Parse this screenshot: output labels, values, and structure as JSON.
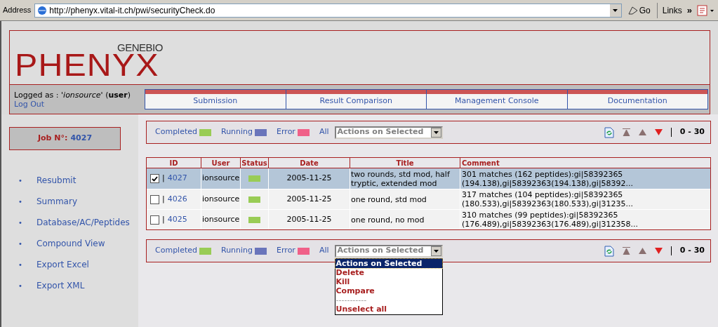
{
  "browser": {
    "address_label": "Address",
    "url": "http://phenyx.vital-it.ch/pwi/securityCheck.do",
    "go_label": "Go",
    "links_label": "Links",
    "chevron": "»"
  },
  "header": {
    "logo_top": "GENEBIO",
    "logo": "PHENYX",
    "logged_as": "Logged as : '*ionsource*' (**user**)",
    "logout": "Log Out",
    "nav_tabs": [
      {
        "label": "Submission"
      },
      {
        "label": "Result Comparison"
      },
      {
        "label": "Management Console"
      },
      {
        "label": "Documentation"
      }
    ]
  },
  "sidebar": {
    "job_label": "Job N°:",
    "job_number": "4027",
    "bullet": "•",
    "links": [
      {
        "label": "Resubmit"
      },
      {
        "label": "Summary"
      },
      {
        "label": "Database/AC/Peptides"
      },
      {
        "label": "Compound View"
      },
      {
        "label": "Export Excel"
      },
      {
        "label": "Export XML"
      }
    ]
  },
  "filter_bars": [
    {
      "legend": [
        {
          "label": "Completed",
          "color": "#99cc55"
        },
        {
          "label": "Running",
          "color": "#6a75bb"
        },
        {
          "label": "Error",
          "color": "#f06088"
        }
      ],
      "all_label": "All",
      "select_value": "Actions on Selected",
      "range": "0 - 30"
    },
    {
      "legend": [
        {
          "label": "Completed",
          "color": "#99cc55"
        },
        {
          "label": "Running",
          "color": "#6a75bb"
        },
        {
          "label": "Error",
          "color": "#f06088"
        }
      ],
      "all_label": "All",
      "select_value": "Actions on Selected",
      "range": "0 - 30",
      "options": [
        {
          "label": "Actions on Selected",
          "selected": true,
          "kind": "option"
        },
        {
          "label": "Delete",
          "selected": false,
          "kind": "option"
        },
        {
          "label": "Kill",
          "selected": false,
          "kind": "option"
        },
        {
          "label": "Compare",
          "selected": false,
          "kind": "option"
        },
        {
          "label": "-----------",
          "selected": false,
          "kind": "separator"
        },
        {
          "label": "Unselect all",
          "selected": false,
          "kind": "option"
        }
      ]
    }
  ],
  "table": {
    "columns": [
      "ID",
      "User",
      "Status",
      "Date",
      "Title",
      "Comment"
    ],
    "rows": [
      {
        "checked": true,
        "id_prefix": "|",
        "id": "4027",
        "user": "ionsource",
        "color": "#99cc55",
        "date": "2005-11-25",
        "title": "two rounds, std mod, half tryptic, extended mod",
        "comment": "301 matches (162 peptides):gi|58392365 (194.138),gi|58392363(194.138),gi|58392..."
      },
      {
        "checked": false,
        "id_prefix": "|",
        "id": "4026",
        "user": "ionsource",
        "color": "#99cc55",
        "date": "2005-11-25",
        "title": "one round, std mod",
        "comment": "317 matches (104 peptides):gi|58392365 (180.533),gi|58392363(180.533),gi|31235..."
      },
      {
        "checked": false,
        "id_prefix": "|",
        "id": "4025",
        "user": "ionsource",
        "color": "#99cc55",
        "date": "2005-11-25",
        "title": "one round, no mod",
        "comment": "310 matches (99 peptides):gi|58392365 (176.489),gi|58392363(176.489),gi|312358..."
      }
    ]
  }
}
